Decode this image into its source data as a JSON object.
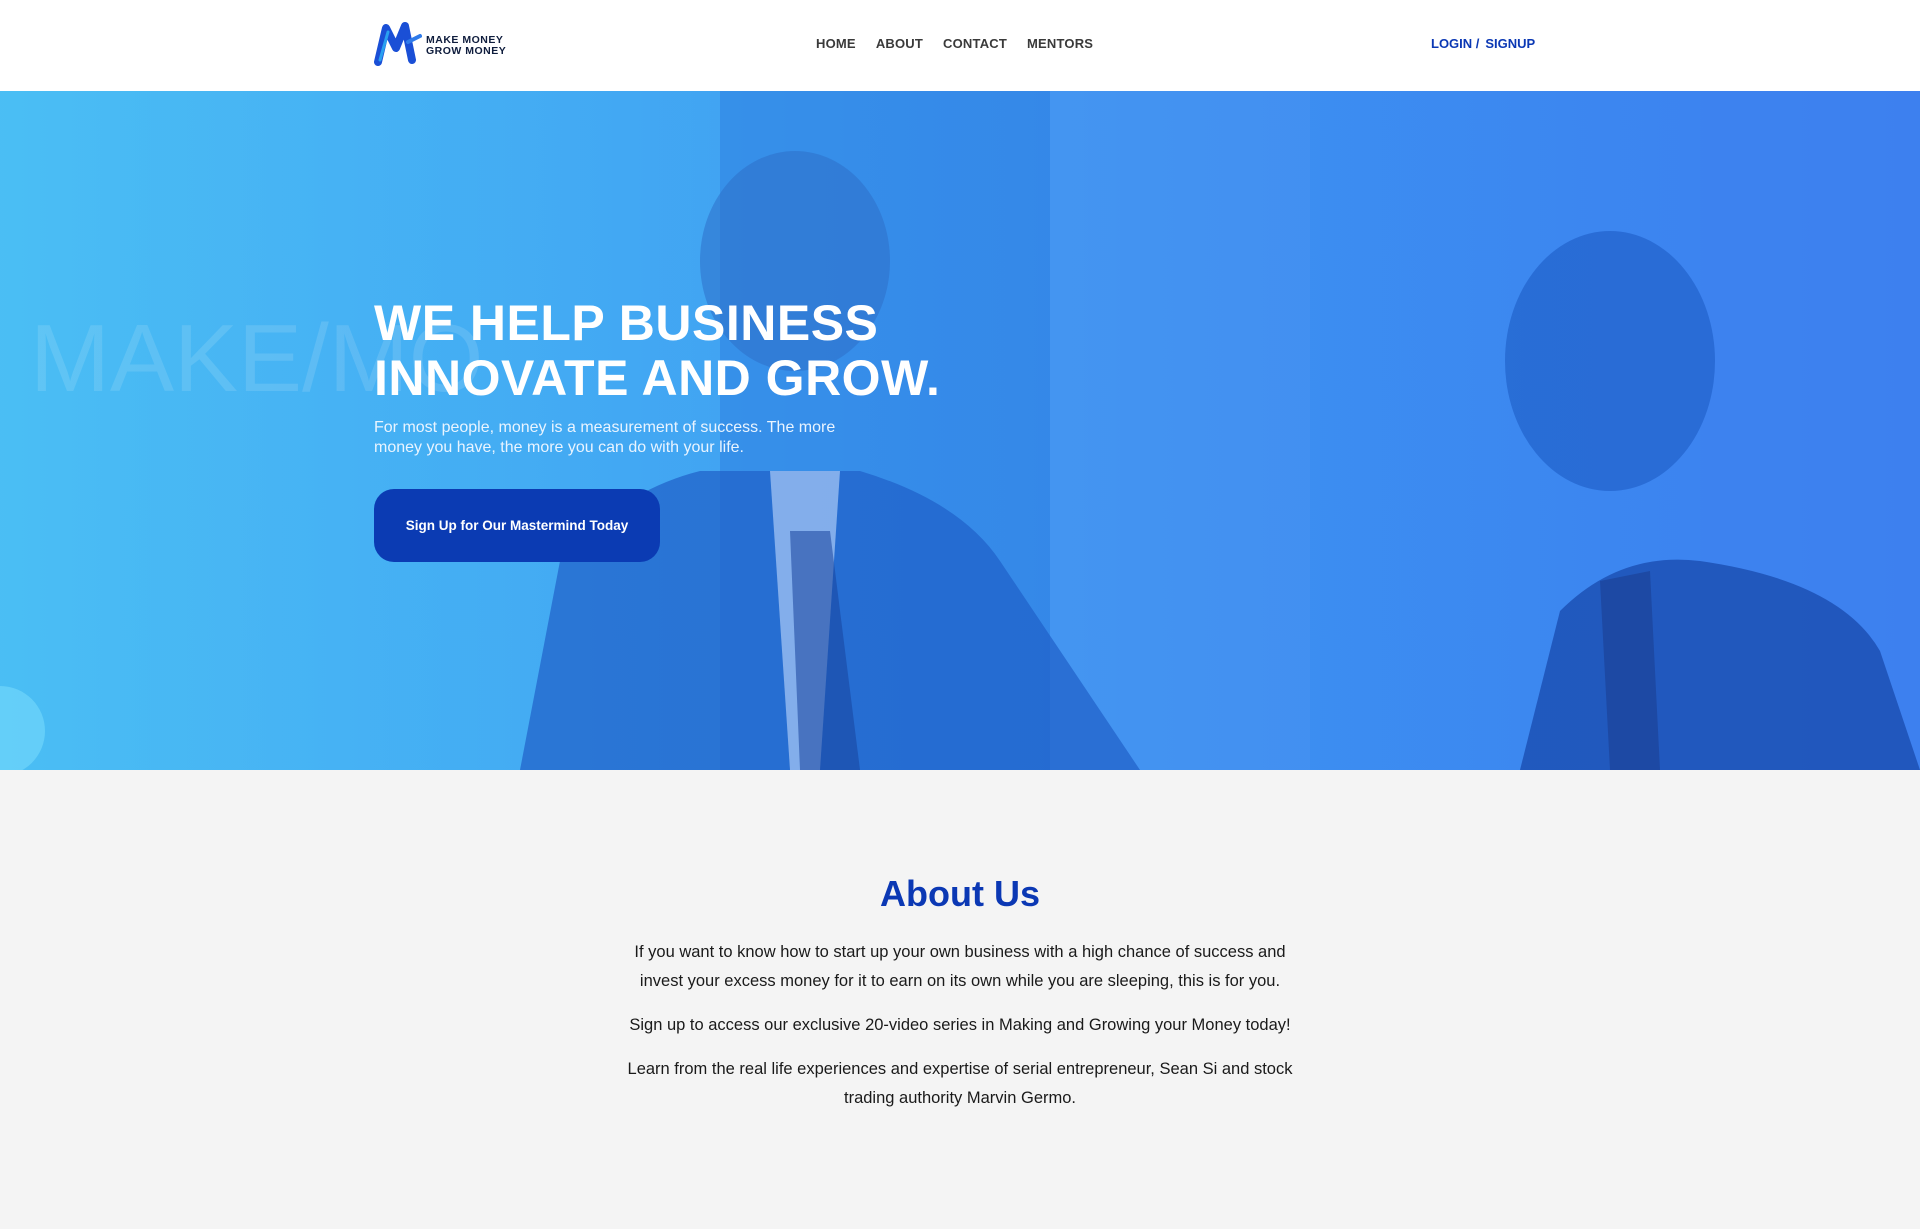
{
  "brand": {
    "logo_line1": "MAKE MONEY",
    "logo_line2": "GROW MONEY",
    "primary_color": "#0b38b4",
    "hero_color": "#3d9af2"
  },
  "nav": {
    "items": [
      {
        "label": "HOME"
      },
      {
        "label": "ABOUT"
      },
      {
        "label": "CONTACT"
      },
      {
        "label": "MENTORS"
      }
    ]
  },
  "auth": {
    "login_label": "LOGIN /",
    "signup_label": "SIGNUP"
  },
  "hero": {
    "title_line1": "WE HELP BUSINESS",
    "title_line2": "INNOVATE AND GROW.",
    "subtitle": "For most people, money is a measurement of success. The more money you have, the more you can do with your life.",
    "cta_label": "Sign Up for Our Mastermind Today",
    "background_watermark": "MAKE/MO"
  },
  "about": {
    "title": "About Us",
    "paragraphs": [
      "If you want to know how to start up your own business with a high chance of success and invest your excess money for it to earn on its own while you are sleeping, this is for you.",
      "Sign up to access our exclusive 20-video series in Making and Growing your Money today!",
      "Learn from the real life experiences and expertise of serial entrepreneur, Sean Si and stock trading authority Marvin Germo."
    ]
  }
}
